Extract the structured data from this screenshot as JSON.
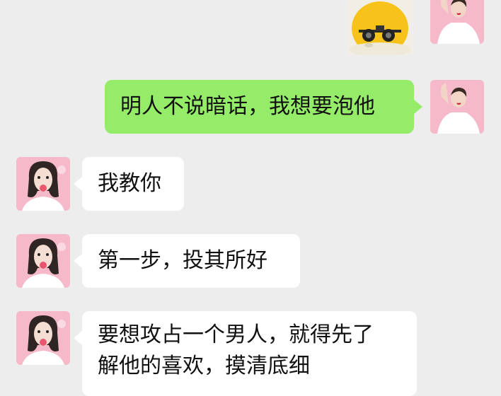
{
  "chat": {
    "messages": [
      {
        "side": "right",
        "type": "sticker",
        "sticker": "sunglasses-chick-sticker"
      },
      {
        "side": "right",
        "type": "text",
        "text": "明人不说暗话，我想要泡他"
      },
      {
        "side": "left",
        "type": "text",
        "text": "我教你"
      },
      {
        "side": "left",
        "type": "text",
        "text": "第一步，投其所好"
      },
      {
        "side": "left",
        "type": "text",
        "lines": [
          "要想攻占一个男人，就得先了",
          "解他的喜欢，摸清底细"
        ]
      }
    ]
  },
  "colors": {
    "background": "#ededed",
    "self_bubble": "#95ec69",
    "other_bubble": "#ffffff",
    "avatar_pink": "#f6b9c9"
  }
}
